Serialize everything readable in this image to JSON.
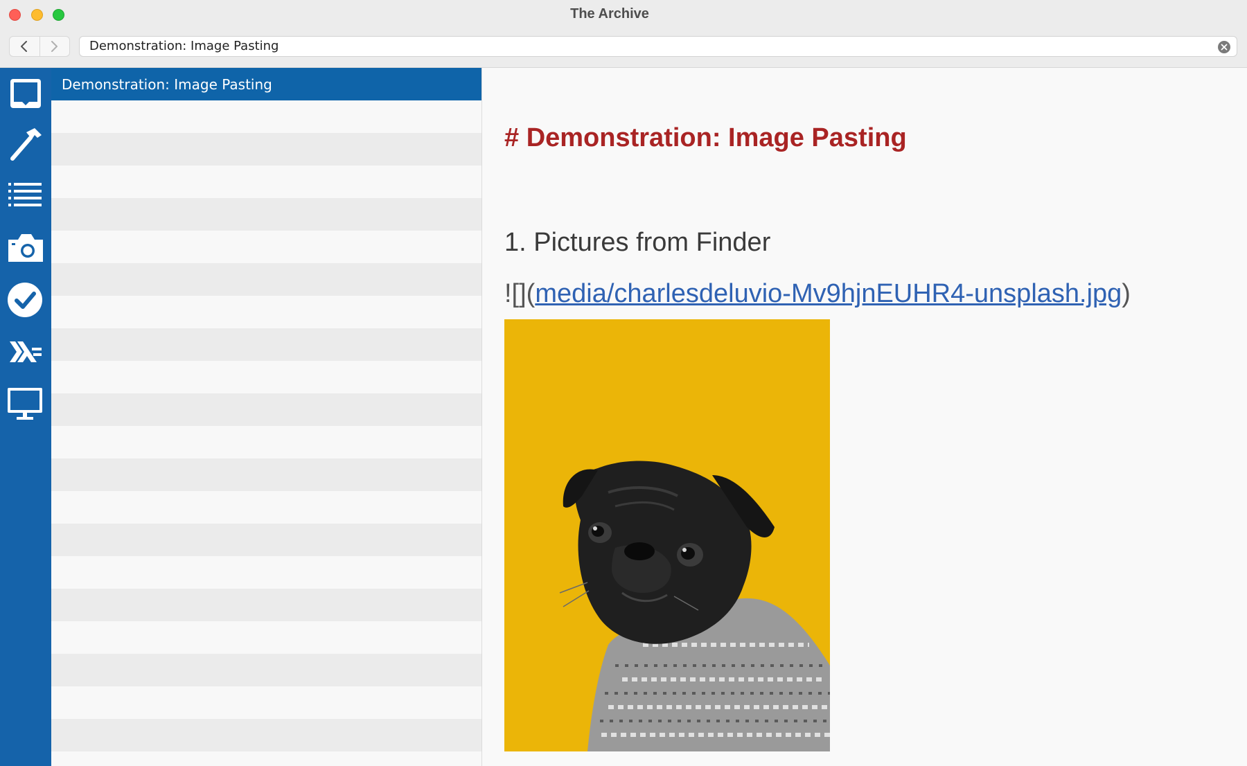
{
  "window": {
    "title": "The Archive"
  },
  "toolbar": {
    "search_value": "Demonstration: Image Pasting"
  },
  "sidebar": {
    "items": [
      {
        "icon": "inbox-icon"
      },
      {
        "icon": "hammer-icon"
      },
      {
        "icon": "list-icon"
      },
      {
        "icon": "camera-icon"
      },
      {
        "icon": "checkmark-icon"
      },
      {
        "icon": "haskell-icon"
      },
      {
        "icon": "monitor-icon"
      }
    ]
  },
  "note_list": {
    "items": [
      {
        "title": "Demonstration: Image Pasting",
        "selected": true
      }
    ]
  },
  "editor": {
    "heading": "# Demonstration: Image Pasting",
    "list_item": "1. Pictures from Finder",
    "image_prefix": "![](",
    "image_link": "media/charlesdeluvio-Mv9hjnEUHR4-unsplash.jpg",
    "image_suffix": ")",
    "image_preview": "pug-photo"
  },
  "colors": {
    "sidebar": "#1563aa",
    "selection": "#0f64a9",
    "heading": "#a92424",
    "link": "#2f62b3",
    "photo_background": "#ebb508"
  }
}
